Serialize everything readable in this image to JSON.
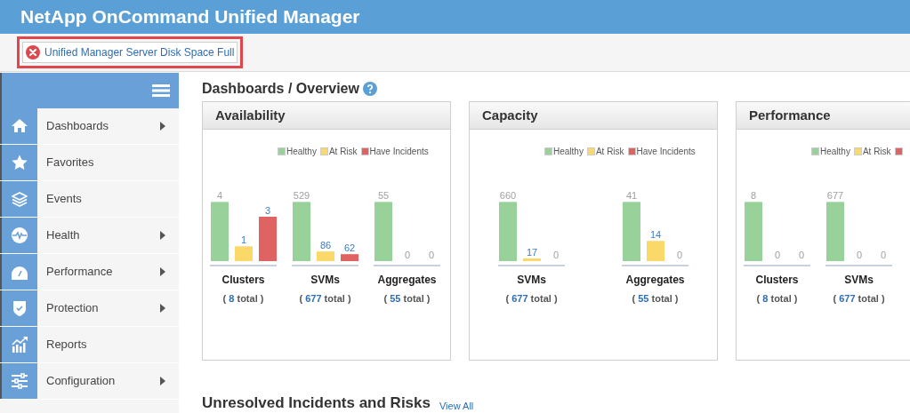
{
  "app_title": "NetApp OnCommand Unified Manager",
  "alert": {
    "text": "Unified Manager Server Disk Space Full"
  },
  "sidebar": {
    "items": [
      {
        "label": "Dashboards",
        "has_submenu": true
      },
      {
        "label": "Favorites",
        "has_submenu": false
      },
      {
        "label": "Events",
        "has_submenu": false
      },
      {
        "label": "Health",
        "has_submenu": true
      },
      {
        "label": "Performance",
        "has_submenu": true
      },
      {
        "label": "Protection",
        "has_submenu": true
      },
      {
        "label": "Reports",
        "has_submenu": false
      },
      {
        "label": "Configuration",
        "has_submenu": true
      }
    ]
  },
  "page_title": "Dashboards / Overview",
  "cards": [
    {
      "title": "Availability",
      "kind": "packed",
      "legend": [
        {
          "label": "Healthy",
          "color": "#98d29a"
        },
        {
          "label": "At Risk",
          "color": "#fbd86a"
        },
        {
          "label": "Have Incidents",
          "color": "#e06363"
        }
      ],
      "groups": [
        {
          "label": "Clusters",
          "total": "( **8** total )",
          "bar_values": [
            "4",
            "1",
            "3"
          ]
        },
        {
          "label": "SVMs",
          "total": "( **677** total )",
          "bar_values": [
            "529",
            "86",
            "62"
          ]
        },
        {
          "label": "Aggregates",
          "total": "( **55** total )",
          "bar_values": [
            "55",
            "0",
            "0"
          ]
        }
      ]
    },
    {
      "title": "Capacity",
      "kind": "spread",
      "legend": [
        {
          "label": "Healthy",
          "color": "#98d29a"
        },
        {
          "label": "At Risk",
          "color": "#fbd86a"
        },
        {
          "label": "Have Incidents",
          "color": "#e06363"
        }
      ],
      "groups": [
        {
          "label": "SVMs",
          "total": "( **677** total )",
          "bar_values": [
            "660",
            "17",
            "0"
          ]
        },
        {
          "label": "Aggregates",
          "total": "( **55** total )",
          "bar_values": [
            "41",
            "14",
            "0"
          ]
        }
      ]
    },
    {
      "title": "Performance",
      "kind": "packed",
      "legend": [
        {
          "label": "Healthy",
          "color": "#98d29a"
        },
        {
          "label": "At Risk",
          "color": "#fbd86a"
        },
        {
          "color": "#e06363"
        }
      ],
      "groups": [
        {
          "label": "Clusters",
          "total": "( **8** total )",
          "bar_values": [
            "8",
            "0",
            "0"
          ]
        },
        {
          "label": "SVMs",
          "total": "( **677** total )",
          "bar_values": [
            "677",
            "0",
            "0"
          ]
        }
      ]
    }
  ],
  "incidents": {
    "title": "Unresolved Incidents and Risks",
    "link": "View All"
  }
}
